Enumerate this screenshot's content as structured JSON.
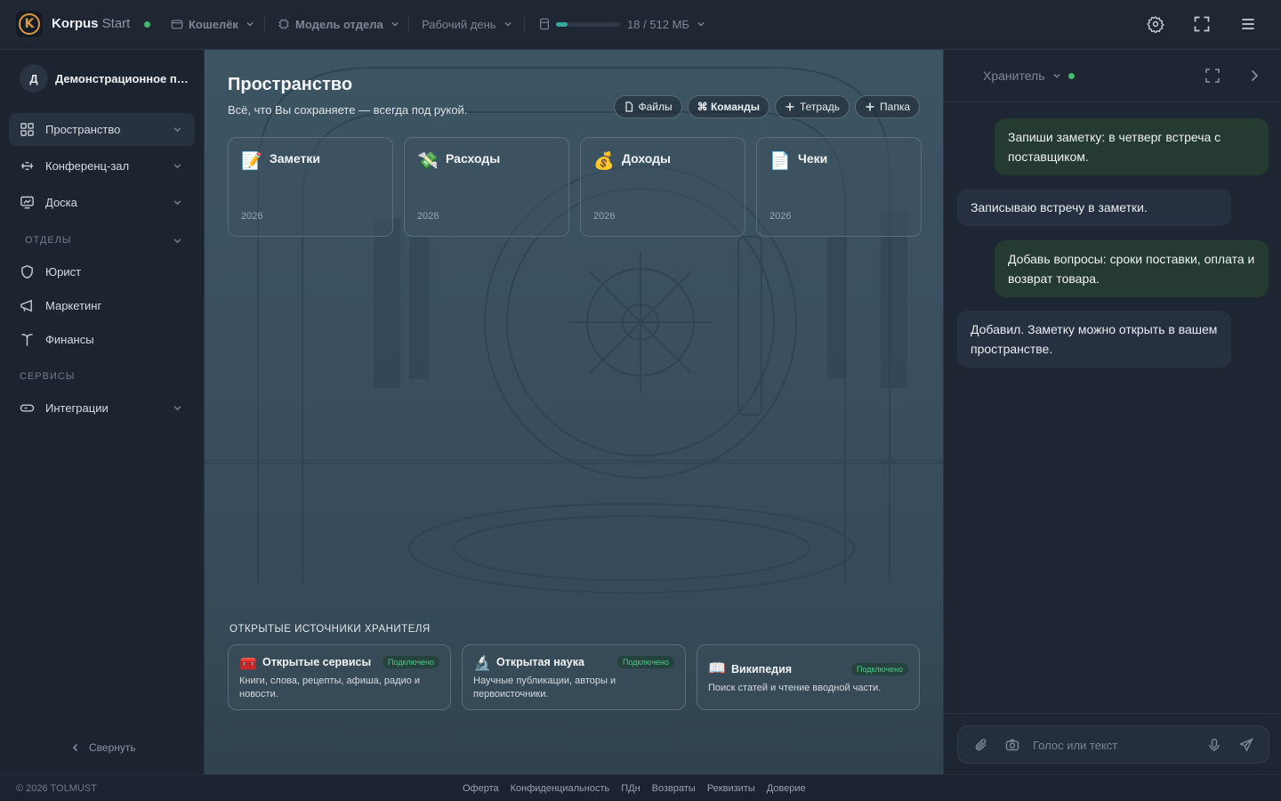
{
  "topbar": {
    "logo_letter": "K",
    "brand": "Korpus",
    "brand_suffix": "Start",
    "wallet": "Кошелёк",
    "model": "Модель отдела",
    "schedule": "Рабочий день",
    "storage_text": "18 / 512 МБ",
    "storage_used_fraction": 0.035
  },
  "sidebar": {
    "workspace_initial": "Д",
    "workspace_name": "Демонстрационное пространство",
    "items": [
      {
        "label": "Пространство"
      },
      {
        "label": "Конференц-зал"
      },
      {
        "label": "Доска"
      }
    ],
    "section_departments": "ОТДЕЛЫ",
    "departments": [
      {
        "label": "Юрист"
      },
      {
        "label": "Маркетинг"
      },
      {
        "label": "Финансы"
      }
    ],
    "section_services": "СЕРВИСЫ",
    "services": [
      {
        "label": "Интеграции"
      }
    ],
    "collapse_label": "Свернуть"
  },
  "main": {
    "title": "Пространство",
    "subtitle": "Всё, что Вы сохраняете — всегда под рукой.",
    "actions": {
      "files": "Файлы",
      "commands": "⌘ Команды",
      "notebook": "Тетрадь",
      "folder": "Папка"
    },
    "cards": [
      {
        "emoji": "📝",
        "title": "Заметки",
        "year": "2026"
      },
      {
        "emoji": "💸",
        "title": "Расходы",
        "year": "2026"
      },
      {
        "emoji": "💰",
        "title": "Доходы",
        "year": "2026"
      },
      {
        "emoji": "📄",
        "title": "Чеки",
        "year": "2026"
      }
    ],
    "sources_label": "ОТКРЫТЫЕ ИСТОЧНИКИ ХРАНИТЕЛЯ",
    "sources": [
      {
        "emoji": "🧰",
        "title": "Открытые сервисы",
        "badge": "Подключено",
        "desc": "Книги, слова, рецепты, афиша, радио и новости."
      },
      {
        "emoji": "🔬",
        "title": "Открытая наука",
        "badge": "Подключено",
        "desc": "Научные публикации, авторы и первоисточники."
      },
      {
        "emoji": "📖",
        "title": "Википедия",
        "badge": "Подключено",
        "desc": "Поиск статей и чтение вводной части."
      }
    ]
  },
  "chat": {
    "agent": "Хранитель",
    "messages": [
      {
        "role": "user",
        "text": "Запиши заметку: в четверг встреча с поставщиком."
      },
      {
        "role": "bot",
        "text": "Записываю встречу в заметки."
      },
      {
        "role": "user",
        "text": "Добавь вопросы: сроки поставки, оплата и возврат товара."
      },
      {
        "role": "bot",
        "text": "Добавил. Заметку можно открыть в вашем пространстве."
      }
    ],
    "placeholder": "Голос или текст"
  },
  "footer": {
    "copyright": "© 2026 TOLMUST",
    "links": [
      "Оферта",
      "Конфиденциальность",
      "ПДн",
      "Возвраты",
      "Реквизиты",
      "Доверие"
    ]
  },
  "colors": {
    "accent_logo": "#d99a45",
    "status_online": "#3dba6a",
    "storage_fill": "#3aa6a0",
    "user_bubble": "#253a31",
    "bot_bubble": "#263040"
  }
}
